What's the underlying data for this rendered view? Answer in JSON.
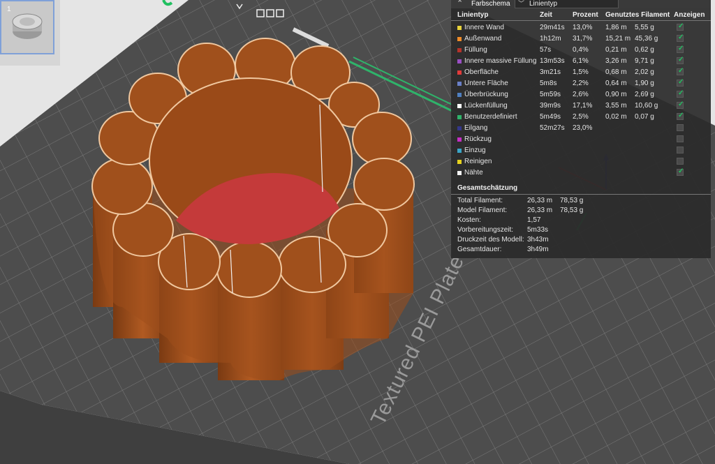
{
  "thumbnail": {
    "index": "1"
  },
  "plate": {
    "label": "Textured PEI Plate"
  },
  "panel": {
    "scheme_label": "Farbschema",
    "scheme_value": "Linientyp",
    "columns": [
      "Linientyp",
      "Zeit",
      "Prozent",
      "Genutztes Filament",
      "Anzeigen"
    ],
    "rows": [
      {
        "name": "Innere Wand",
        "color": "#e8d23a",
        "time": "29m41s",
        "percent": "13,0%",
        "length": "1,86 m",
        "weight": "5,55 g",
        "shown": true
      },
      {
        "name": "Außenwand",
        "color": "#f08c28",
        "time": "1h12m",
        "percent": "31,7%",
        "length": "15,21 m",
        "weight": "45,36 g",
        "shown": true
      },
      {
        "name": "Füllung",
        "color": "#b5332a",
        "time": "57s",
        "percent": "0,4%",
        "length": "0,21 m",
        "weight": "0,62 g",
        "shown": true
      },
      {
        "name": "Innere massive Füllung",
        "color": "#9a4fc4",
        "time": "13m53s",
        "percent": "6,1%",
        "length": "3,26 m",
        "weight": "9,71 g",
        "shown": true
      },
      {
        "name": "Oberfläche",
        "color": "#e23a3a",
        "time": "3m21s",
        "percent": "1,5%",
        "length": "0,68 m",
        "weight": "2,02 g",
        "shown": true
      },
      {
        "name": "Untere Fläche",
        "color": "#6a80c8",
        "time": "5m8s",
        "percent": "2,2%",
        "length": "0,64 m",
        "weight": "1,90 g",
        "shown": true
      },
      {
        "name": "Überbrückung",
        "color": "#4f7fc0",
        "time": "5m59s",
        "percent": "2,6%",
        "length": "0,90 m",
        "weight": "2,69 g",
        "shown": true
      },
      {
        "name": "Lückenfüllung",
        "color": "#ffffff",
        "time": "39m9s",
        "percent": "17,1%",
        "length": "3,55 m",
        "weight": "10,60 g",
        "shown": true
      },
      {
        "name": "Benutzerdefiniert",
        "color": "#2fb36a",
        "time": "5m49s",
        "percent": "2,5%",
        "length": "0,02 m",
        "weight": "0,07 g",
        "shown": true
      },
      {
        "name": "Eilgang",
        "color": "#34378a",
        "time": "52m27s",
        "percent": "23,0%",
        "length": "",
        "weight": "",
        "shown": false
      },
      {
        "name": "Rückzug",
        "color": "#c42fc4",
        "time": "",
        "percent": "",
        "length": "",
        "weight": "",
        "shown": false
      },
      {
        "name": "Einzug",
        "color": "#3aa6c8",
        "time": "",
        "percent": "",
        "length": "",
        "weight": "",
        "shown": false
      },
      {
        "name": "Reinigen",
        "color": "#e6d21e",
        "time": "",
        "percent": "",
        "length": "",
        "weight": "",
        "shown": false
      },
      {
        "name": "Nähte",
        "color": "#f2f2f2",
        "time": "",
        "percent": "",
        "length": "",
        "weight": "",
        "shown": true
      }
    ],
    "summary_title": "Gesamtschätzung",
    "summary": [
      {
        "label": "Total Filament:",
        "v1": "26,33 m",
        "v2": "78,53 g"
      },
      {
        "label": "Model Filament:",
        "v1": "26,33 m",
        "v2": "78,53 g"
      },
      {
        "label": "Kosten:",
        "v1": "1,57",
        "v2": ""
      },
      {
        "label": "Vorbereitungszeit:",
        "v1": "5m33s",
        "v2": ""
      },
      {
        "label": "Druckzeit des Modell:",
        "v1": "3h43m",
        "v2": ""
      },
      {
        "label": "Gesamtdauer:",
        "v1": "3h49m",
        "v2": ""
      }
    ]
  },
  "colors": {
    "model_orange": "#a0501c",
    "model_rim": "#f0c8a0",
    "top_surface_red": "#c43a3a",
    "bed": "#4d4d4d",
    "grid": "#7a7a7a"
  }
}
